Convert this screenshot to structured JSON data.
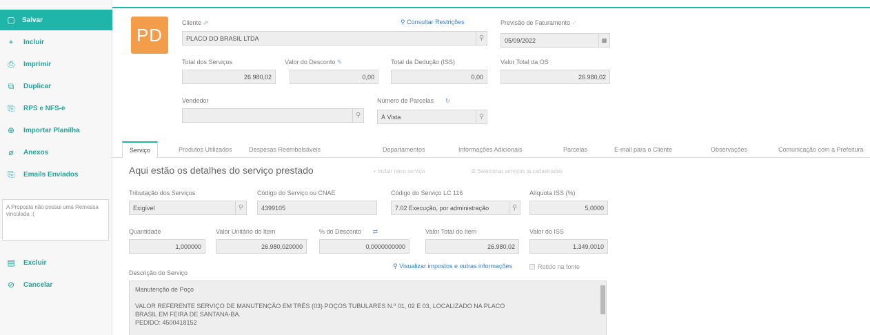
{
  "sidebar": {
    "items": [
      {
        "label": "Salvar",
        "icon": "save-icon",
        "glyph": "▢"
      },
      {
        "label": "Incluir",
        "icon": "plus-icon",
        "glyph": "+"
      },
      {
        "label": "Imprimir",
        "icon": "printer-icon",
        "glyph": "⎙"
      },
      {
        "label": "Duplicar",
        "icon": "duplicate-icon",
        "glyph": "⧉"
      },
      {
        "label": "RPS e NFS-e",
        "icon": "document-send-icon",
        "glyph": "⎘"
      },
      {
        "label": "Importar Planilha",
        "icon": "import-icon",
        "glyph": "⊕"
      },
      {
        "label": "Anexos",
        "icon": "paperclip-icon",
        "glyph": "⌀"
      },
      {
        "label": "Emails Enviados",
        "icon": "send-icon",
        "glyph": "⎘"
      },
      {
        "label": "Excluir",
        "icon": "trash-icon",
        "glyph": "▤"
      },
      {
        "label": "Cancelar",
        "icon": "cancel-icon",
        "glyph": "⊘"
      }
    ],
    "note": "A Proposta não possui uma Remessa vinculada :("
  },
  "header": {
    "avatar": "PD",
    "cliente_label": "Cliente",
    "cliente_value": "PLACO DO BRASIL LTDA",
    "consultar_link": "Consultar Restrições",
    "previsao_label": "Previsão de Faturamento",
    "previsao_value": "05/09/2022",
    "total_servicos_label": "Total dos Serviços",
    "total_servicos_value": "26.980,02",
    "valor_desconto_label": "Valor do Desconto",
    "valor_desconto_value": "0,00",
    "total_deducao_label": "Total da Dedução (ISS)",
    "total_deducao_value": "0,00",
    "valor_total_os_label": "Valor Total da OS",
    "valor_total_os_value": "26.980,02",
    "vendedor_label": "Vendedor",
    "vendedor_value": "",
    "parcelas_label": "Número de Parcelas",
    "parcelas_value": "À Vista"
  },
  "tabs": [
    "Serviço",
    "Produtos Utilizados",
    "Despesas Reembolsáveis",
    "Departamentos",
    "Informações Adicionais",
    "Parcelas",
    "E-mail para o Cliente",
    "Observações",
    "Comunicação com a Prefeitura"
  ],
  "servico": {
    "title": "Aqui estão os detalhes do serviço prestado",
    "incluir_novo": "Incluir novo serviço",
    "selecionar": "Selecionar serviços já cadastrados",
    "tributacao_label": "Tributação dos Serviços",
    "tributacao_value": "Exigível",
    "codigo_cnae_label": "Código do Serviço ou CNAE",
    "codigo_cnae_value": "4399105",
    "codigo_lc_label": "Código do Serviço LC 116",
    "codigo_lc_value": "7.02   Execução, por administração",
    "aliquota_label": "Alíquota ISS (%)",
    "aliquota_value": "5,0000",
    "quantidade_label": "Quantidade",
    "quantidade_value": "1,000000",
    "valor_unitario_label": "Valor Unitário do Item",
    "valor_unitario_value": "26.980,020000",
    "perc_desconto_label": "% do Desconto",
    "perc_desconto_value": "0,0000000000",
    "valor_total_item_label": "Valor Total do Item",
    "valor_total_item_value": "26.980,02",
    "valor_iss_label": "Valor do ISS",
    "valor_iss_value": "1.349,0010",
    "visualizar_link": "Visualizar impostos e outras informações",
    "retido_label": "Retido na fonte",
    "descricao_label": "Descrição do Serviço",
    "descricao_lines": [
      "Manutenção de Poço",
      "",
      "VALOR REFERENTE SERVIÇO DE MANUTENÇÃO EM TRÊS (03) POÇOS TUBULARES N.º 01, 02 E 03, LOCALIZADO NA PLACO",
      "BRASIL EM FEIRA DE SANTANA-BA.",
      "PEDIDO: 4500418152"
    ]
  },
  "colors": {
    "accent": "#1fb5a9",
    "avatar": "#f39c4a",
    "link": "#3a7fc4"
  }
}
